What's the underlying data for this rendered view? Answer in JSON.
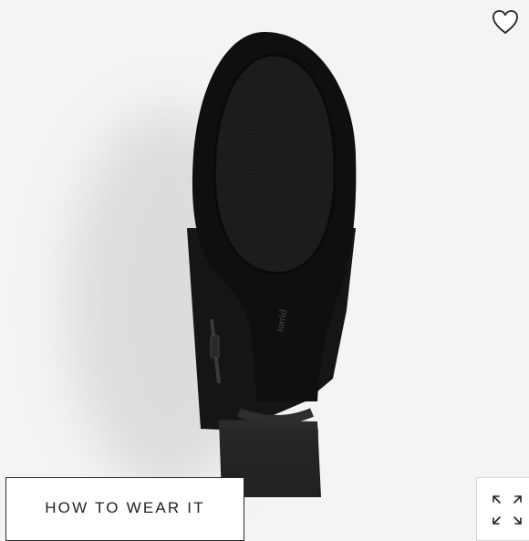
{
  "product_image": {
    "alt": "Black suede block-heel bootie, bottom sole view",
    "sole_brand_mark": "torrid"
  },
  "wishlist": {
    "icon": "heart-outline-icon"
  },
  "how_to_wear": {
    "label": "HOW TO WEAR IT"
  },
  "expand": {
    "icon": "expand-arrows-icon"
  },
  "colors": {
    "background": "#f4f4f4",
    "button_border": "#2a2a2a",
    "icon": "#222222"
  }
}
